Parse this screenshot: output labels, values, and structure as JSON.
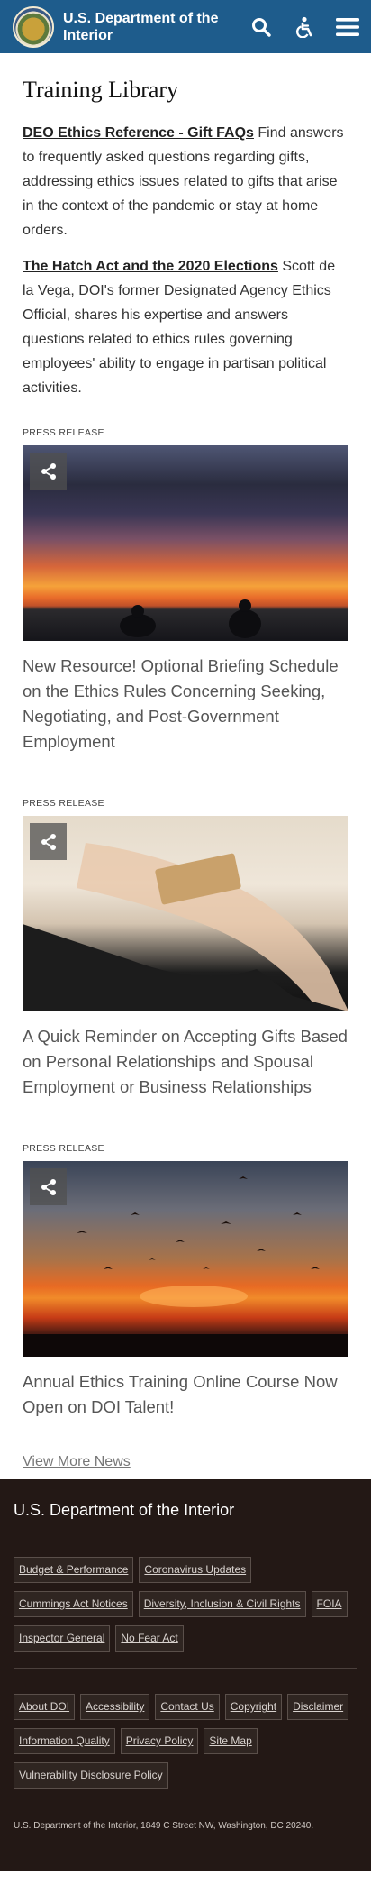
{
  "header": {
    "agency_name": "U.S. Department of the Interior",
    "colors": {
      "bar": "#1e5c8c"
    },
    "icons": [
      "doi-seal",
      "search-icon",
      "accessibility-icon",
      "menu-icon"
    ]
  },
  "main": {
    "page_title": "Training Library",
    "resources": [
      {
        "link": "DEO Ethics Reference - Gift FAQs",
        "text": " Find answers to frequently asked questions regarding gifts, addressing ethics issues related to gifts that arise in the context of the pandemic or stay at home orders."
      },
      {
        "link": "The Hatch Act and the 2020 Elections",
        "text": "  Scott de la Vega, DOI's former Designated Agency Ethics Official, shares his expertise and answers questions related to ethics rules governing employees' ability to engage in partisan political activities."
      }
    ],
    "cards": [
      {
        "eyebrow": "PRESS RELEASE",
        "title": "New Resource! Optional Briefing Schedule on the Ethics Rules Concerning Seeking, Negotiating, and Post-Government Employment"
      },
      {
        "eyebrow": "PRESS RELEASE",
        "title": "A Quick Reminder on Accepting Gifts Based on Personal Relationships and Spousal Employment or Business Relationships"
      },
      {
        "eyebrow": "PRESS RELEASE",
        "title": "Annual Ethics Training Online Course Now Open on DOI Talent!"
      }
    ],
    "view_more": "View More News"
  },
  "footer": {
    "title": "U.S. Department of the Interior",
    "links_primary": [
      "Budget & Performance",
      "Coronavirus Updates",
      "Cummings Act Notices",
      "Diversity, Inclusion & Civil Rights",
      "FOIA",
      "Inspector General",
      "No Fear Act"
    ],
    "links_secondary": [
      "About DOI",
      "Accessibility",
      "Contact Us",
      "Copyright",
      "Disclaimer",
      "Information Quality",
      "Privacy Policy",
      "Site Map",
      "Vulnerability Disclosure Policy"
    ],
    "address": "U.S. Department of the Interior, 1849 C Street NW, Washington, DC 20240.",
    "colors": {
      "background": "#231815"
    }
  }
}
